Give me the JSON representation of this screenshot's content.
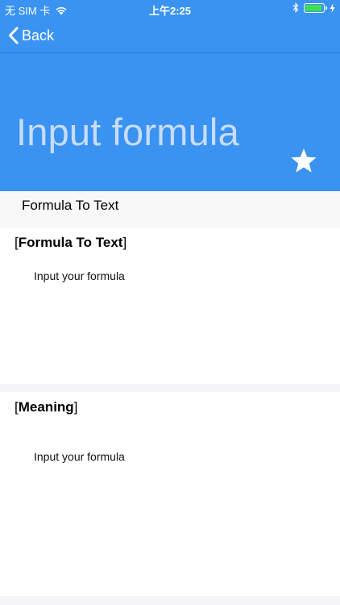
{
  "status_bar": {
    "carrier": "无 SIM 卡",
    "time": "上午2:25",
    "wifi_icon": "wifi-icon",
    "bluetooth_icon": "bluetooth-icon",
    "battery_icon": "battery-icon",
    "battery_level": 0.9,
    "charging_icon": "charging-bolt-icon"
  },
  "nav": {
    "back_label": "Back",
    "back_icon": "chevron-left-icon"
  },
  "header": {
    "title": "Input formula",
    "star_icon": "star-icon"
  },
  "section": {
    "label": "Formula To Text"
  },
  "cards": [
    {
      "title_open": "[",
      "title": "Formula To Text",
      "title_close": "]",
      "body": "Input your formula"
    },
    {
      "title_open": "[",
      "title": "Meaning",
      "title_close": "]",
      "body": "Input your formula"
    }
  ],
  "colors": {
    "primary_blue": "#3a93f1",
    "header_text": "#c8dcfa",
    "battery_green": "#3ee04d",
    "background": "#f5f5f7"
  }
}
